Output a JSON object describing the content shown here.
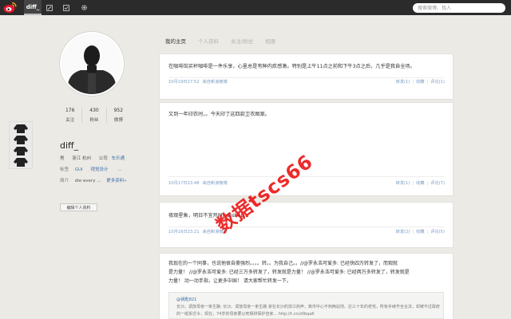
{
  "topbar": {
    "username": "diff_",
    "nav_icons": [
      "edit-icon",
      "bookmark-icon",
      "gear-icon"
    ],
    "search_placeholder": "搜索微博、找人"
  },
  "profile": {
    "stats": [
      {
        "num": "176",
        "label": "关注"
      },
      {
        "num": "430",
        "label": "粉丝"
      },
      {
        "num": "952",
        "label": "微博"
      }
    ],
    "name": "diff_",
    "gender": "男",
    "location": "浙江 杭州",
    "company_label": "公司",
    "company": "车乐通",
    "tags_label": "标签",
    "tags": [
      "GUI",
      "视觉设计",
      "..."
    ],
    "bio_label": "简介",
    "bio": "die every ...",
    "more_link": "更多资料»",
    "edit_button": "编辑个人资料"
  },
  "tabs": [
    {
      "label": "我的主页",
      "active": true
    },
    {
      "label": "个人资料",
      "active": false
    },
    {
      "label": "关注/粉丝",
      "active": false
    },
    {
      "label": "相册",
      "active": false
    }
  ],
  "feed": [
    {
      "text": "在咖啡馆买杯咖啡是一件乐享，心里总是有种内疚感激。特别是上午11点之前和下午3点之后，几乎是我自全场。",
      "time": "10月19日17:52",
      "source": "来自新浪微博",
      "actions": {
        "forward": "转发(1)",
        "fav": "收藏",
        "comment": "评论(1)"
      }
    },
    {
      "text": "又到一年印衣时。。今天印了这四款卫衣图案。",
      "time": "10月17日13:48",
      "source": "来自新浪微博",
      "actions": {
        "forward": "转发(1)",
        "fav": "收藏",
        "comment": "评论(7)"
      }
    },
    {
      "text": "夜观星象，明日不宜开Photoshop...",
      "time": "10月16日23:21",
      "source": "来自新浪微博",
      "actions": {
        "forward": "转发(2)",
        "fav": "收藏",
        "comment": "评论(5)"
      }
    },
    {
      "text_lines": [
        "我现在的一个同事，也说他很自豪强烈。。。。转。。为我自己。。//@罗永浩可爱多: 已经快四万转发了，而观就",
        "是力量！ //@罗永浩可爱多: 已经三万多转发了，转发就是力量！ //@罗永浩可爱多: 已经两万多转发了，转发就是",
        "力量！ 动一动手指，让更多中国！ 请大家帮忙转发一下。"
      ],
      "quote_author": "@钥匙821",
      "quote_text": "长沙。调放母亲一条生路: 长沙。调放母亲一条生路 家在长沙的浙江商声，离市中心不到两站地，近三十年的老宅，所有手续齐全合法，却被不过政府的一纸拆迁令，现在，74岁的母亲要以死相拼保护自家... http://t.cn/z0bqaK"
    }
  ],
  "watermark": "数据tscs66"
}
